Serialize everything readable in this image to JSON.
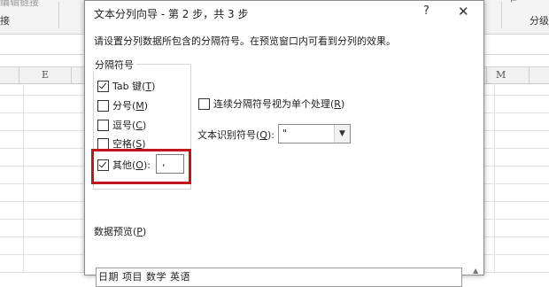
{
  "ribbon": {
    "edit_links": "编辑链接",
    "group_left": "接",
    "group_right": "分级"
  },
  "columns": [
    "E",
    "M"
  ],
  "dialog": {
    "title": "文本分列向导 - 第 2 步，共 3 步",
    "help": "?",
    "close": "✕",
    "intro": "请设置分列数据所包含的分隔符号。在预览窗口内可看到分列的效果。",
    "delimiters_legend": "分隔符号",
    "delimiters": [
      {
        "label": "Tab 键(T)",
        "text": "Tab 键(",
        "key": "T",
        "checked": true
      },
      {
        "label": "分号(M)",
        "text": "分号(",
        "key": "M",
        "checked": false
      },
      {
        "label": "逗号(C)",
        "text": "逗号(",
        "key": "C",
        "checked": false
      },
      {
        "label": "空格(S)",
        "text": "空格(",
        "key": "S",
        "checked": false
      },
      {
        "label": "其他(O):",
        "text": "其他(",
        "key": "O",
        "checked": true
      }
    ],
    "other_value": ",",
    "consecutive": {
      "text": "连续分隔符号视为单个处理(",
      "key": "R",
      "checked": false
    },
    "qualifier": {
      "text": "文本识别符号(",
      "key": "Q",
      "value": "\""
    },
    "preview": {
      "text": "数据预览(",
      "key": "P",
      "header_row": "日期  项目  数学  英语"
    }
  }
}
